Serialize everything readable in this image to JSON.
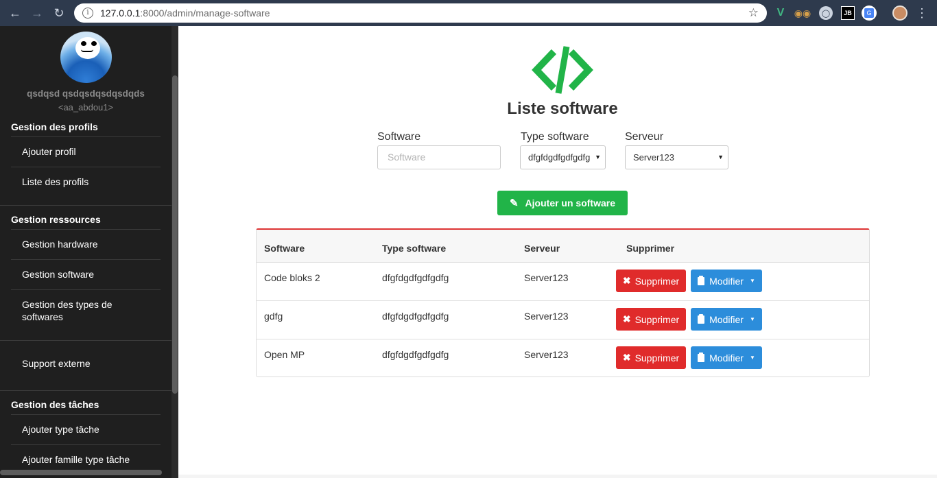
{
  "browser": {
    "url_host": "127.0.0.1",
    "url_path": ":8000/admin/manage-software"
  },
  "sidebar": {
    "user_name": "qsdqsd qsdqsdqsdqsdqds",
    "user_handle": "<aa_abdou1>",
    "sections": [
      {
        "title": "Gestion des profils",
        "items": [
          "Ajouter profil",
          "Liste des profils"
        ]
      },
      {
        "title": "Gestion ressources",
        "items": [
          "Gestion hardware",
          "Gestion software",
          "Gestion des types de softwares"
        ]
      },
      {
        "title": "",
        "items": [
          "Support externe"
        ]
      },
      {
        "title": "Gestion des tâches",
        "items": [
          "Ajouter type tâche",
          "Ajouter famille type tâche"
        ]
      }
    ]
  },
  "main": {
    "title": "Liste software",
    "form": {
      "software_label": "Software",
      "software_placeholder": "Software",
      "type_label": "Type software",
      "type_value": "dfgfdgdfgdfgdfg",
      "server_label": "Serveur",
      "server_value": "Server123"
    },
    "add_button": "Ajouter un software",
    "table": {
      "headers": [
        "Software",
        "Type software",
        "Serveur",
        "Supprimer"
      ],
      "rows": [
        {
          "software": "Code bloks 2",
          "type": "dfgfdgdfgdfgdfg",
          "server": "Server123"
        },
        {
          "software": "gdfg",
          "type": "dfgfdgdfgdfgdfg",
          "server": "Server123"
        },
        {
          "software": "Open MP",
          "type": "dfgfdgdfgdfgdfg",
          "server": "Server123"
        }
      ],
      "delete_label": "Supprimer",
      "modify_label": "Modifier"
    }
  },
  "colors": {
    "brand_green": "#21b448",
    "danger": "#e02b2b",
    "primary": "#2c8ddb",
    "sidebar_bg": "#1f1f1f",
    "chrome_bg": "#2e3a4d"
  }
}
